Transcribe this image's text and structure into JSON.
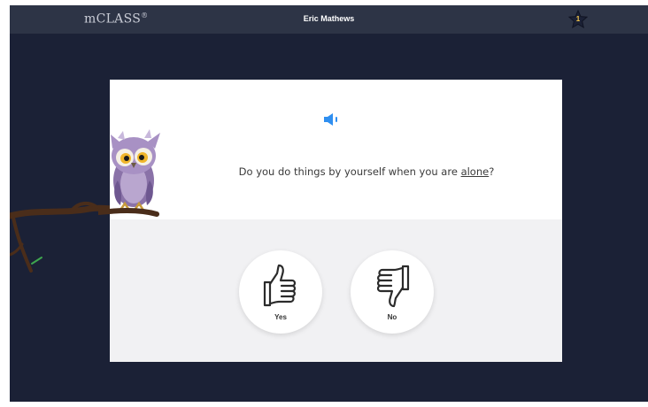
{
  "header": {
    "logo": "mCLASS",
    "logo_mark": "®",
    "user_name": "Eric Mathews",
    "star_count": "1"
  },
  "question": {
    "text_before": "Do you do things by yourself when you are ",
    "keyword": "alone",
    "text_after": "?"
  },
  "answers": {
    "yes_label": "Yes",
    "no_label": "No"
  },
  "icons": {
    "speaker": "speaker-icon",
    "thumbs_up": "thumbs-up-icon",
    "thumbs_down": "thumbs-down-icon",
    "star": "star-icon",
    "mascot": "owl-mascot"
  },
  "colors": {
    "background": "#1b2136",
    "topbar": "#2d3446",
    "accent": "#2f8ff0",
    "star": "#f3c64b"
  }
}
